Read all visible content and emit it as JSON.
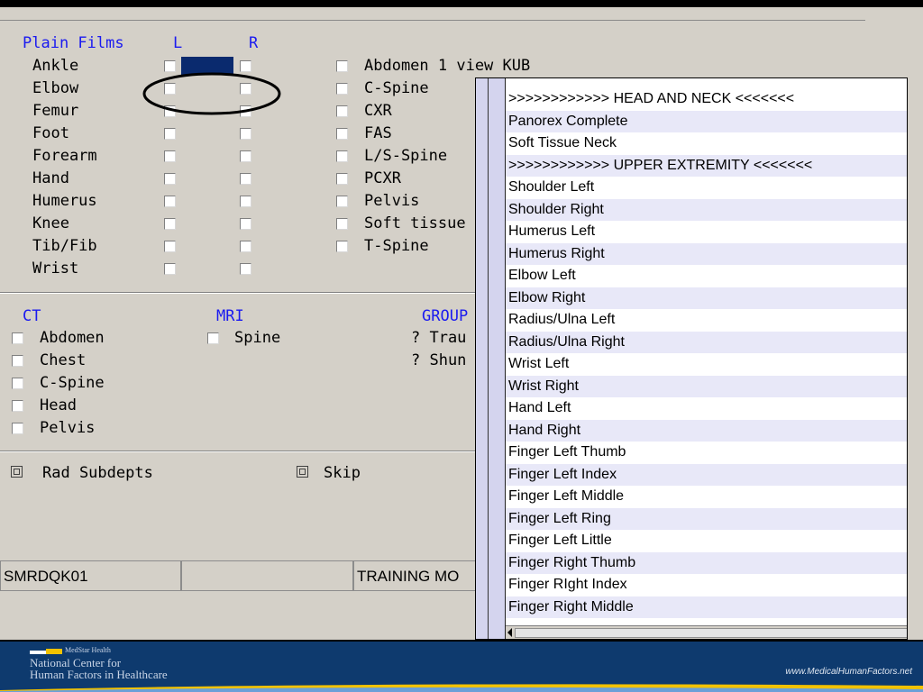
{
  "plain_films": {
    "header": "Plain Films",
    "col_left": "L",
    "col_right": "R",
    "rows": [
      "Ankle",
      "Elbow",
      "Femur",
      "Foot",
      "Forearm",
      "Hand",
      "Humerus",
      "Knee",
      "Tib/Fib",
      "Wrist"
    ]
  },
  "single_views": [
    "Abdomen 1 view KUB",
    "C-Spine",
    "CXR",
    "FAS",
    "L/S-Spine",
    "PCXR",
    "Pelvis",
    "Soft tissue",
    "T-Spine"
  ],
  "ct": {
    "header": "CT",
    "items": [
      "Abdomen",
      "Chest",
      "C-Spine",
      "Head",
      "Pelvis"
    ]
  },
  "mri": {
    "header": "MRI",
    "items": [
      "Spine"
    ]
  },
  "group": {
    "header": "GROUP",
    "items": [
      "? Trau",
      "? Shun"
    ]
  },
  "buttons": {
    "rad_subdepts": "Rad Subdepts",
    "skip": "Skip"
  },
  "status": {
    "field1": "SMRDQK01",
    "field2": "",
    "field3": "TRAINING MO"
  },
  "popup": {
    "items": [
      ">>>>>>>>>>>>  HEAD AND NECK  <<<<<<<",
      "Panorex Complete",
      "Soft Tissue Neck",
      ">>>>>>>>>>>>  UPPER EXTREMITY  <<<<<<<",
      "Shoulder Left",
      "Shoulder Right",
      "Humerus Left",
      "Humerus Right",
      "Elbow Left",
      "Elbow Right",
      "Radius/Ulna Left",
      "Radius/Ulna Right",
      "Wrist Left",
      "Wrist Right",
      "Hand Left",
      "Hand Right",
      "Finger Left Thumb",
      "Finger Left Index",
      "Finger Left Middle",
      "Finger Left Ring",
      "Finger Left Little",
      "Finger Right Thumb",
      "Finger RIght Index",
      "Finger Right Middle"
    ]
  },
  "footer": {
    "org_small": "MedStar Health",
    "org_line1": "National Center for",
    "org_line2": "Human Factors in Healthcare",
    "url": "www.MedicalHumanFactors.net"
  },
  "colors": {
    "header_blue": "#1a1af0",
    "footer_bg": "#0e3a6e",
    "highlight": "#0a2a6e",
    "annotation": "#000000"
  }
}
